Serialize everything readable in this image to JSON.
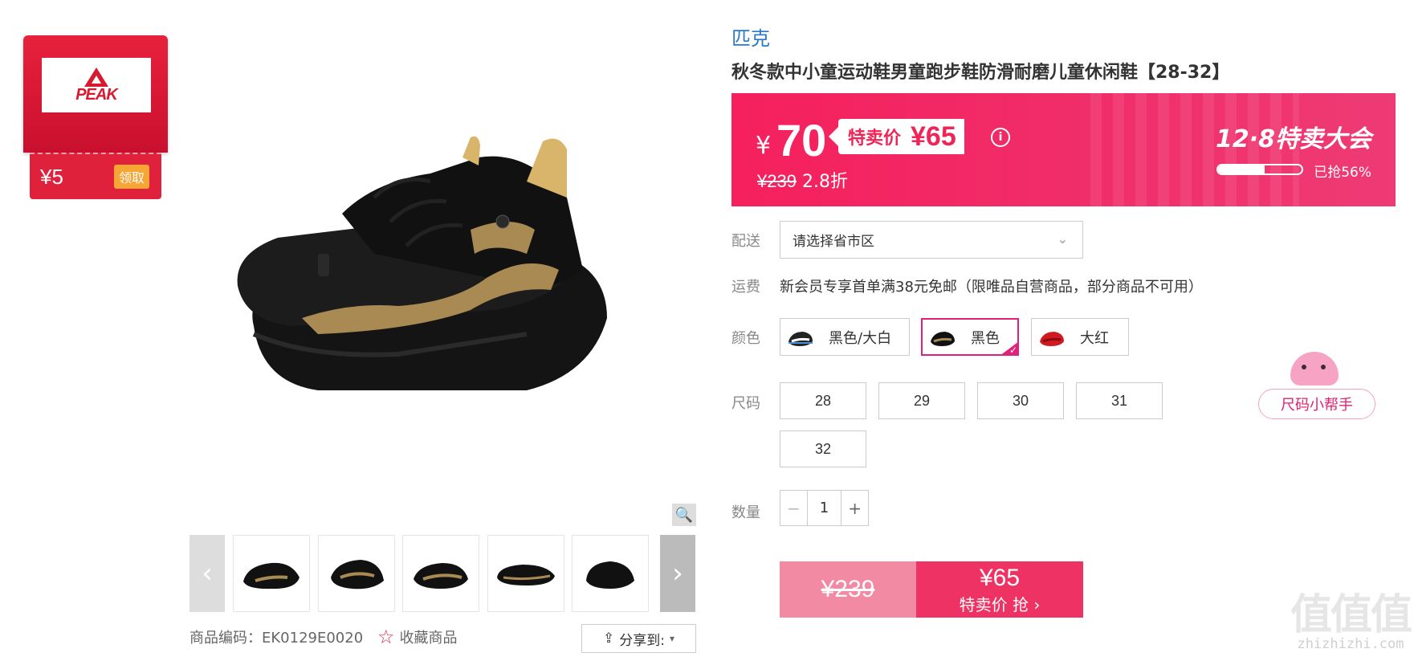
{
  "coupon": {
    "amount": "¥5",
    "claim_label": "领取",
    "logo_text": "PEAK"
  },
  "product": {
    "brand": "匹克",
    "title": "秋冬款中小童运动鞋男童跑步鞋防滑耐磨儿童休闲鞋【28-32】",
    "code_label": "商品编码：EK0129E0020",
    "favorite_label": "收藏商品",
    "share_label": "分享到:"
  },
  "price": {
    "currency": "¥",
    "now": "70",
    "special_label": "特卖价",
    "special_value": "¥65",
    "original": "¥239",
    "discount": "2.8折",
    "event": "12·8特卖大会",
    "grabbed": "已抢56%",
    "grabbed_fraction": 0.56
  },
  "delivery": {
    "label": "配送",
    "placeholder": "请选择省市区"
  },
  "shipping": {
    "label": "运费",
    "text": "新会员专享首单满38元免邮（限唯品自营商品，部分商品不可用）"
  },
  "colors": {
    "label": "颜色",
    "options": [
      {
        "name": "黑色/大白",
        "selected": false
      },
      {
        "name": "黑色",
        "selected": true
      },
      {
        "name": "大红",
        "selected": false
      }
    ]
  },
  "sizes": {
    "label": "尺码",
    "options": [
      "28",
      "29",
      "30",
      "31",
      "32"
    ],
    "helper": "尺码小帮手"
  },
  "quantity": {
    "label": "数量",
    "value": "1",
    "minus": "−",
    "plus": "+"
  },
  "buy": {
    "original": "¥239",
    "price": "¥65",
    "action": "特卖价 抢 ›"
  },
  "watermark": {
    "big": "值值值",
    "small": "zhizhizhi.com"
  },
  "colors_theme": {
    "accent": "#ee3264",
    "brand_blue": "#2a79c9",
    "coupon_red": "#d71a2f"
  }
}
